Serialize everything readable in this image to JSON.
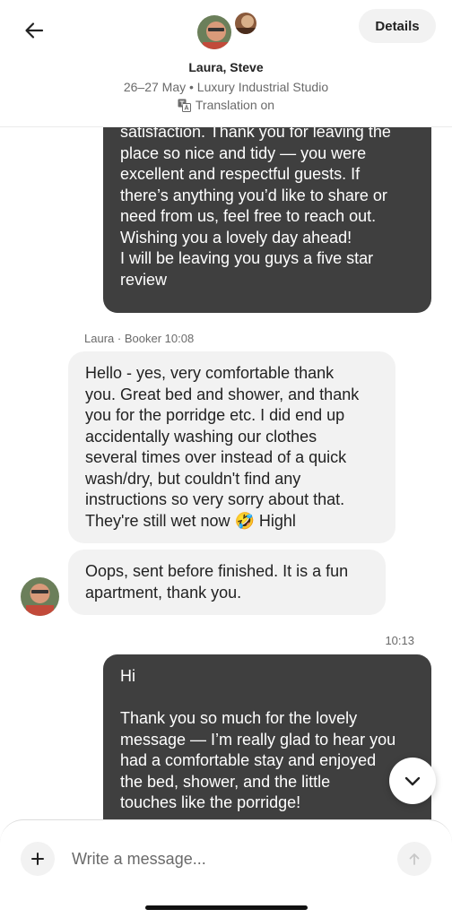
{
  "header": {
    "back_icon": "arrow-left-icon",
    "details_label": "Details",
    "title": "Laura, Steve",
    "subtitle": "26–27 May • Luxury Industrial Studio",
    "translation_label": "Translation on",
    "translation_icon": "translate-icon"
  },
  "messages": [
    {
      "lines": [
        "satisfaction. Thank you for leaving the",
        "place so nice and tidy — you were",
        "excellent and respectful guests. If",
        "there’s anything you’d like to share or",
        "need from us, feel free to reach out.",
        "Wishing you a lovely day ahead!",
        "I will be leaving you guys a five star",
        "review"
      ]
    },
    {
      "sender": "Laura",
      "role": "Booker",
      "time": "10:08",
      "lines": [
        "Hello - yes, very comfortable thank",
        "you. Great bed and shower, and thank",
        "you for the porridge etc. I did end up",
        "accidentally washing our clothes",
        "several times over instead of a quick",
        "wash/dry, but couldn't find any",
        "instructions so very sorry about that.",
        "They're still wet now 🤣 Highl"
      ]
    },
    {
      "lines": [
        "Oops, sent before finished. It is a fun",
        "apartment, thank you."
      ]
    },
    {
      "time": "10:13",
      "lines": [
        "Hi",
        "",
        "Thank you so much for the lovely",
        "message — I’m really glad to hear you",
        "had a comfortable stay and enjoyed",
        "the bed, shower, and the little",
        "touches like the porridge!"
      ]
    }
  ],
  "composer": {
    "placeholder": "Write a message...",
    "plus_icon": "plus-icon",
    "send_icon": "arrow-up-icon"
  },
  "colors": {
    "outgoing_bubble": "#3f3f3f",
    "incoming_bubble": "#f2f2f2",
    "text_primary": "#222222",
    "text_secondary": "#6a6a6a"
  }
}
